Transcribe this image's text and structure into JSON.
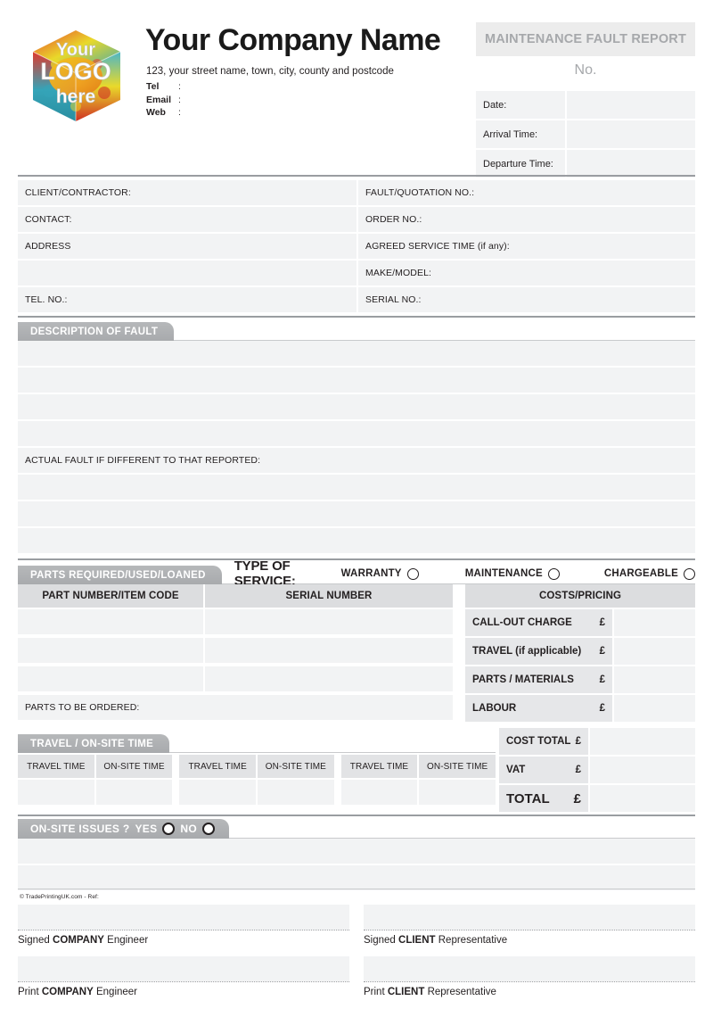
{
  "header": {
    "logo": {
      "line1": "Your",
      "line2": "LOGO",
      "line3": "here",
      "alt": "puzzle-cube-logo"
    },
    "company_name": "Your Company Name",
    "address": "123, your street name, town, city, county and postcode",
    "contacts": [
      {
        "key": "Tel",
        "colon": ":",
        "value": ""
      },
      {
        "key": "Email",
        "colon": ":",
        "value": ""
      },
      {
        "key": "Web",
        "colon": ":",
        "value": ""
      }
    ],
    "doc_title": "MAINTENANCE FAULT REPORT",
    "doc_no_label": "No.",
    "meta": [
      {
        "label": "Date:",
        "value": ""
      },
      {
        "label": "Arrival Time:",
        "value": ""
      },
      {
        "label": "Departure Time:",
        "value": ""
      }
    ]
  },
  "info": {
    "left": [
      "CLIENT/CONTRACTOR:",
      "CONTACT:",
      "ADDRESS",
      "",
      "TEL. NO.:"
    ],
    "right": [
      "FAULT/QUOTATION NO.:",
      "ORDER NO.:",
      "AGREED SERVICE TIME (if any):",
      "MAKE/MODEL:",
      "SERIAL NO.:"
    ]
  },
  "description": {
    "tab_label": "DESCRIPTION OF FAULT",
    "blank_rows_top": [
      "",
      "",
      "",
      ""
    ],
    "actual_fault_label": "ACTUAL FAULT IF DIFFERENT TO THAT REPORTED:",
    "blank_rows_bottom": [
      "",
      "",
      ""
    ]
  },
  "service": {
    "parts_tab_label": "PARTS REQUIRED/USED/LOANED",
    "type_of_service_label": "TYPE OF SERVICE:",
    "options": [
      {
        "label": "WARRANTY",
        "selected": false
      },
      {
        "label": "MAINTENANCE",
        "selected": false
      },
      {
        "label": "CHARGEABLE",
        "selected": false
      }
    ],
    "parts_headers": [
      "PART NUMBER/ITEM CODE",
      "SERIAL NUMBER"
    ],
    "parts_rows": [
      {
        "part_number": "",
        "serial_number": ""
      },
      {
        "part_number": "",
        "serial_number": ""
      },
      {
        "part_number": "",
        "serial_number": ""
      }
    ],
    "parts_to_be_ordered_label": "PARTS TO BE ORDERED:",
    "costs_header": "COSTS/PRICING",
    "currency": "£",
    "cost_rows": [
      {
        "label": "CALL-OUT CHARGE",
        "value": ""
      },
      {
        "label": "TRAVEL (if applicable)",
        "value": ""
      },
      {
        "label": "PARTS / MATERIALS",
        "value": ""
      },
      {
        "label": "LABOUR",
        "value": ""
      }
    ]
  },
  "travel": {
    "tab_label": "TRAVEL / ON-SITE TIME",
    "pairs": [
      {
        "travel_header": "TRAVEL TIME",
        "onsite_header": "ON-SITE TIME",
        "travel_value": "",
        "onsite_value": ""
      },
      {
        "travel_header": "TRAVEL TIME",
        "onsite_header": "ON-SITE TIME",
        "travel_value": "",
        "onsite_value": ""
      },
      {
        "travel_header": "TRAVEL TIME",
        "onsite_header": "ON-SITE TIME",
        "travel_value": "",
        "onsite_value": ""
      }
    ]
  },
  "totals": {
    "currency": "£",
    "rows": [
      {
        "label": "COST TOTAL",
        "value": ""
      },
      {
        "label": "VAT",
        "value": ""
      },
      {
        "label": "TOTAL",
        "value": ""
      }
    ]
  },
  "issues": {
    "tab_label": "ON-SITE ISSUES ?",
    "yes_label": "YES",
    "no_label": "NO",
    "yes_selected": false,
    "no_selected": false,
    "blank_rows": [
      "",
      ""
    ]
  },
  "footer": {
    "copyright": "© TradePrintingUK.com - Ref:",
    "signatures": [
      {
        "prefix": "Signed ",
        "strong": "COMPANY",
        "suffix": " Engineer",
        "value": ""
      },
      {
        "prefix": "Signed ",
        "strong": "CLIENT",
        "suffix": " Representative",
        "value": ""
      },
      {
        "prefix": "Print ",
        "strong": "COMPANY",
        "suffix": " Engineer",
        "value": ""
      },
      {
        "prefix": "Print ",
        "strong": "CLIENT",
        "suffix": " Representative",
        "value": ""
      }
    ]
  },
  "colors": {
    "field_fill": "#f2f3f4",
    "header_fill": "#dcdddf",
    "tab_gray": "#aaacaf",
    "rule": "#9a9da1",
    "muted_text": "#a6a8ab",
    "logo_red": "#d62f26",
    "logo_teal": "#35a4b8",
    "logo_yellow": "#e8d420",
    "logo_orange": "#f0a020"
  }
}
